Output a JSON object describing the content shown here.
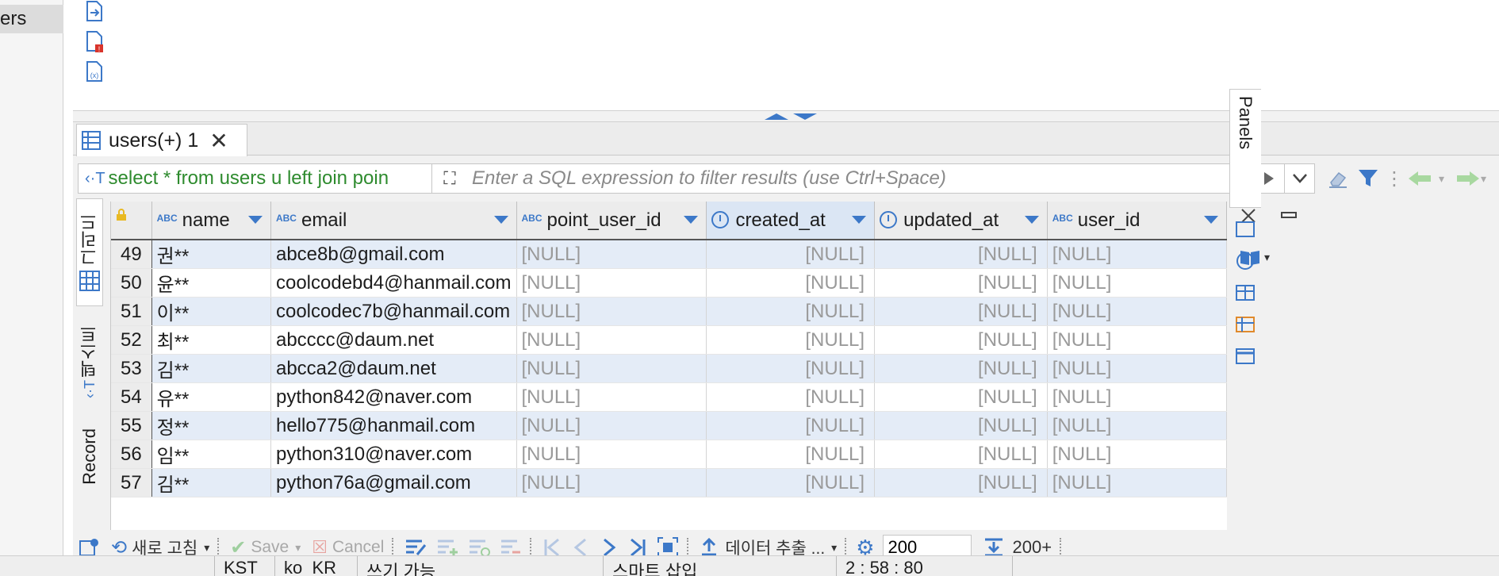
{
  "tree": {
    "selected_item": "ers"
  },
  "result_tab": {
    "label": "users(+) 1",
    "close": "✕"
  },
  "filter": {
    "sql": "select * from users u left join poin",
    "placeholder": "Enter a SQL expression to filter results (use Ctrl+Space)"
  },
  "side_tabs": {
    "grid": "그리드",
    "text": "텍스트",
    "record": "Record"
  },
  "panels_tab": "Panels",
  "grid": {
    "columns": [
      {
        "type": "ABC",
        "name": "name"
      },
      {
        "type": "ABC",
        "name": "email"
      },
      {
        "type": "ABC",
        "name": "point_user_id"
      },
      {
        "type": "clock",
        "name": "created_at"
      },
      {
        "type": "clock",
        "name": "updated_at"
      },
      {
        "type": "ABC",
        "name": "user_id"
      }
    ],
    "rows": [
      {
        "num": "49",
        "name": "권**",
        "email": "abce8b@gmail.com",
        "point_user_id": "[NULL]",
        "created_at": "[NULL]",
        "updated_at": "[NULL]",
        "user_id": "[NULL]"
      },
      {
        "num": "50",
        "name": "윤**",
        "email": "coolcodebd4@hanmail.com",
        "point_user_id": "[NULL]",
        "created_at": "[NULL]",
        "updated_at": "[NULL]",
        "user_id": "[NULL]"
      },
      {
        "num": "51",
        "name": "이**",
        "email": "coolcodec7b@hanmail.com",
        "point_user_id": "[NULL]",
        "created_at": "[NULL]",
        "updated_at": "[NULL]",
        "user_id": "[NULL]"
      },
      {
        "num": "52",
        "name": "최**",
        "email": "abcccc@daum.net",
        "point_user_id": "[NULL]",
        "created_at": "[NULL]",
        "updated_at": "[NULL]",
        "user_id": "[NULL]"
      },
      {
        "num": "53",
        "name": "김**",
        "email": "abcca2@daum.net",
        "point_user_id": "[NULL]",
        "created_at": "[NULL]",
        "updated_at": "[NULL]",
        "user_id": "[NULL]"
      },
      {
        "num": "54",
        "name": "유**",
        "email": "python842@naver.com",
        "point_user_id": "[NULL]",
        "created_at": "[NULL]",
        "updated_at": "[NULL]",
        "user_id": "[NULL]"
      },
      {
        "num": "55",
        "name": "정**",
        "email": "hello775@hanmail.com",
        "point_user_id": "[NULL]",
        "created_at": "[NULL]",
        "updated_at": "[NULL]",
        "user_id": "[NULL]"
      },
      {
        "num": "56",
        "name": "임**",
        "email": "python310@naver.com",
        "point_user_id": "[NULL]",
        "created_at": "[NULL]",
        "updated_at": "[NULL]",
        "user_id": "[NULL]"
      },
      {
        "num": "57",
        "name": "김**",
        "email": "python76a@gmail.com",
        "point_user_id": "[NULL]",
        "created_at": "[NULL]",
        "updated_at": "[NULL]",
        "user_id": "[NULL]"
      }
    ]
  },
  "toolbar": {
    "refresh": "새로 고침",
    "save": "Save",
    "cancel": "Cancel",
    "export": "데이터 추출 ...",
    "fetch_size": "200",
    "fetch_more": "200+"
  },
  "status": {
    "timezone": "KST",
    "locale": "ko_KR",
    "mode": "쓰기 가능",
    "insert": "스마트 삽입",
    "position": "2 : 58 : 80"
  },
  "colors": {
    "accent": "#3c78c8",
    "sql_green": "#2e8b2e",
    "alt_row": "#e4ecf7"
  }
}
